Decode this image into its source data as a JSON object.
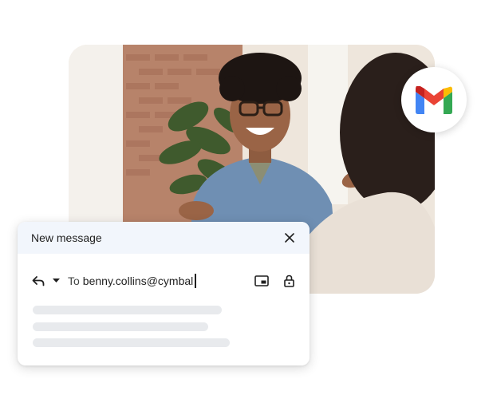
{
  "photo": {
    "description_icon": "photo-of-people-meeting"
  },
  "badge": {
    "icon": "gmail-logo-icon",
    "colors": {
      "red": "#EA4335",
      "blue": "#4285F4",
      "green": "#34A853",
      "yellow": "#FBBC04",
      "darkred": "#C5221F"
    }
  },
  "compose": {
    "title": "New message",
    "close_icon": "close-icon",
    "reply_icon": "reply-icon",
    "caret_icon": "chevron-down-icon",
    "to_label": "To",
    "to_value": "benny.collins@cymbal",
    "pip_icon": "picture-in-picture-icon",
    "lock_icon": "lock-icon"
  },
  "colors": {
    "header_bg": "#f2f6fc",
    "placeholder_line": "#e8eaed"
  }
}
